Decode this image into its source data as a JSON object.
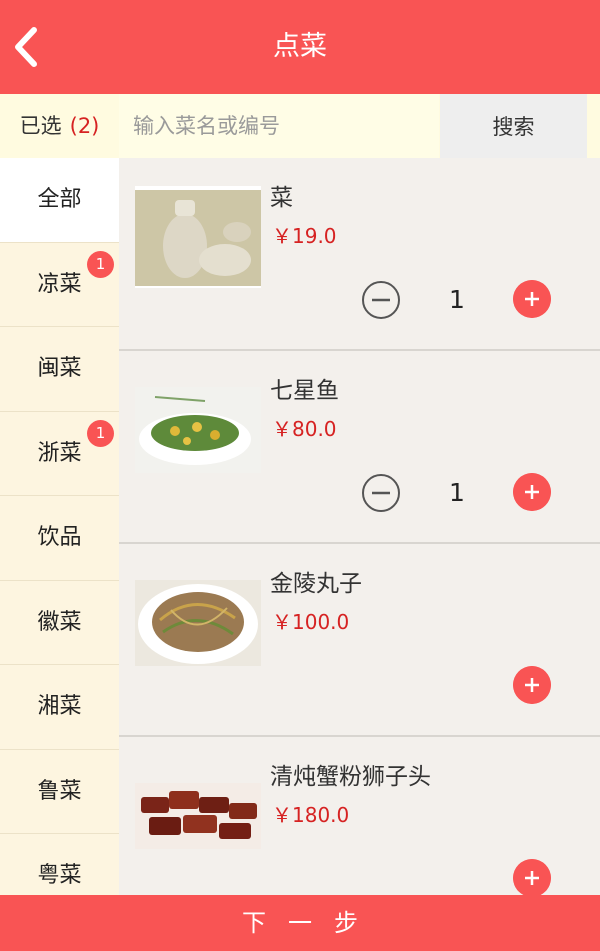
{
  "header": {
    "title": "点菜",
    "back_icon": "chevron-left-icon"
  },
  "search": {
    "selected_label": "已选",
    "selected_count": "(2)",
    "placeholder": "输入菜名或编号",
    "button_label": "搜索"
  },
  "categories": [
    {
      "label": "全部",
      "active": true,
      "badge": ""
    },
    {
      "label": "凉菜",
      "badge": "1"
    },
    {
      "label": "闽菜",
      "badge": ""
    },
    {
      "label": "浙菜",
      "badge": "1"
    },
    {
      "label": "饮品",
      "badge": ""
    },
    {
      "label": "徽菜",
      "badge": ""
    },
    {
      "label": "湘菜",
      "badge": ""
    },
    {
      "label": "鲁菜",
      "badge": ""
    },
    {
      "label": "粤菜",
      "badge": ""
    }
  ],
  "dishes": [
    {
      "name": "菜",
      "price": "￥19.0",
      "quantity": "1",
      "image": "milk-bottle-photo"
    },
    {
      "name": "七星鱼",
      "price": "￥80.0",
      "quantity": "1",
      "image": "green-bean-dish-photo"
    },
    {
      "name": "金陵丸子",
      "price": "￥100.0",
      "quantity": "",
      "image": "shredded-stir-fry-photo"
    },
    {
      "name": "清炖蟹粉狮子头",
      "price": "￥180.0",
      "quantity": "",
      "image": "braised-ribs-photo"
    }
  ],
  "footer": {
    "next_label": "下一步"
  },
  "colors": {
    "accent": "#f95454",
    "price": "#d62222",
    "sidebar_bg": "#fdf5e0",
    "search_bg": "#fffbe0"
  }
}
